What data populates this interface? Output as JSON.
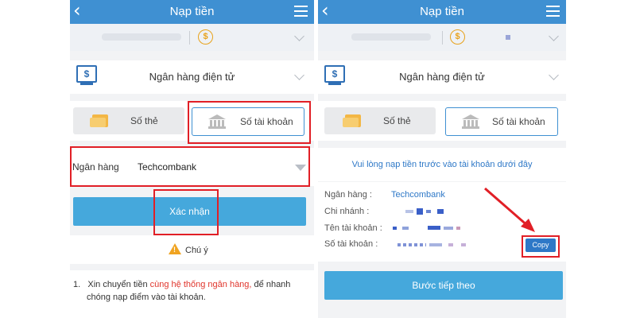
{
  "header": {
    "title": "Nạp tiền"
  },
  "method": {
    "label": "Ngân hàng điện tử"
  },
  "tabs": {
    "card_label": "Số thẻ",
    "account_label": "Số tài khoản"
  },
  "left": {
    "bank_field_label": "Ngân hàng",
    "bank_field_value": "Techcombank",
    "confirm_label": "Xác nhận",
    "warning_title": "Chú ý",
    "note_number": "1.",
    "note_text_before": "Xin chuyển tiền ",
    "note_text_highlight": "cùng hệ thống ngân hàng,",
    "note_text_after": " để nhanh",
    "note_text_line2": "chóng nạp điểm vào tài khoản."
  },
  "right": {
    "instruction": "Vui lòng nạp tiền trước vào tài khoản dưới đây",
    "bank_label": "Ngân hàng :",
    "bank_value": "Techcombank",
    "branch_label": "Chi nhánh :",
    "account_name_label": "Tên tài khoản :",
    "account_number_label": "Số tài khoản :",
    "copy_label": "Copy",
    "next_label": "Bước tiếp theo"
  },
  "icons": {
    "back": "chevron-left-icon",
    "menu": "hamburger-menu-icon",
    "coin": "dollar-coin-icon",
    "monitor": "monitor-dollar-icon",
    "card": "credit-card-icon",
    "bank": "bank-building-icon",
    "warning": "warning-triangle-icon"
  },
  "colors": {
    "header": "#3f90d2",
    "button": "#45a8dc",
    "highlight": "#e11f26",
    "accent_text": "#2e78c7"
  }
}
